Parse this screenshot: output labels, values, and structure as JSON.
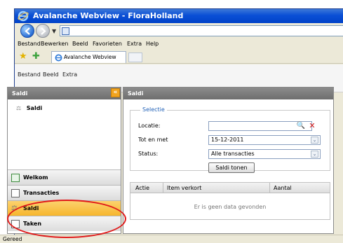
{
  "window": {
    "title": "Avalanche Webview - FloraHolland"
  },
  "menu": [
    "Bestand",
    "Bewerken",
    "Beeld",
    "Favorieten",
    "Extra",
    "Help"
  ],
  "favorites_tab": {
    "label": "Avalanche Webview"
  },
  "app_menu": [
    "Bestand",
    "Beeld",
    "Extra"
  ],
  "left_panel": {
    "header": "Saldi",
    "tree_item": "Saldi",
    "nav": [
      {
        "label": "Welkom",
        "icon": "welcome-icon"
      },
      {
        "label": "Transacties",
        "icon": "transactions-icon"
      },
      {
        "label": "Saldi",
        "icon": "balances-icon",
        "active": true
      },
      {
        "label": "Taken",
        "icon": "tasks-icon"
      }
    ]
  },
  "right_panel": {
    "header": "Saldi",
    "selection": {
      "legend": "Selectie",
      "locatie_label": "Locatie:",
      "locatie_value": "",
      "tot_label": "Tot en met",
      "tot_value": "15-12-2011",
      "status_label": "Status:",
      "status_value": "Alle transacties",
      "button": "Saldi tonen"
    },
    "grid": {
      "columns": [
        "Actie",
        "Item verkort",
        "Aantal"
      ],
      "empty_message": "Er is geen data gevonden"
    }
  },
  "status_bar": {
    "text": "Gereed"
  },
  "colors": {
    "accent": "#f6b62d",
    "annotation": "#e01a1a",
    "legend": "#2463b8"
  }
}
